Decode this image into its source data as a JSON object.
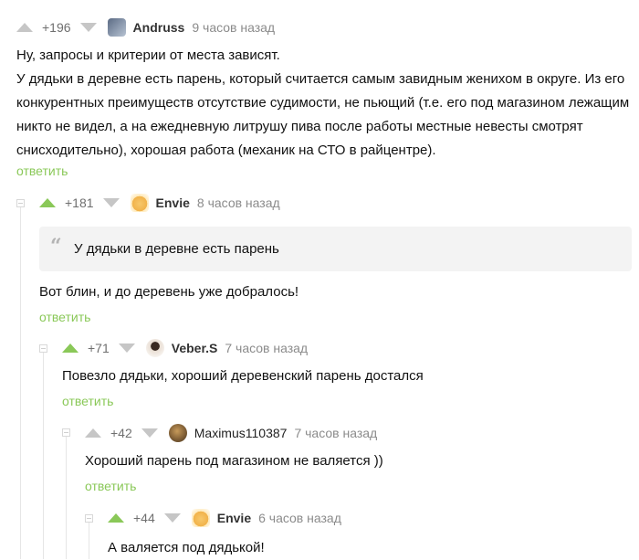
{
  "comments": [
    {
      "score": "+196",
      "author": "Andruss",
      "time": "9 часов назад",
      "lines": [
        "Ну, запросы и критерии от места зависят.",
        "У дядьки в деревне есть парень, который считается самым завидным женихом в округе. Из его",
        "конкурентных преимуществ отсутствие судимости, не пьющий (т.е. его под магазином лежащим",
        "никто не видел, а на ежедневную литрушу пива после работы местные невесты смотрят",
        "снисходительно), хорошая работа (механик на СТО в райцентре)."
      ],
      "reply": "ответить"
    },
    {
      "score": "+181",
      "author": "Envie",
      "time": "8 часов назад",
      "quote": "У дядьки в деревне есть парень",
      "text": "Вот блин, и до деревень уже добралось!",
      "reply": "ответить"
    },
    {
      "score": "+71",
      "author": "Veber.S",
      "time": "7 часов назад",
      "text": "Повезло дядьки, хороший деревенский парень достался",
      "reply": "ответить"
    },
    {
      "score": "+42",
      "author": "Maximus110387",
      "time": "7 часов назад",
      "text": "Хороший парень под магазином не валяется ))",
      "reply": "ответить"
    },
    {
      "score": "+44",
      "author": "Envie",
      "time": "6 часов назад",
      "text": "А валяется под дядькой!"
    }
  ],
  "colors": {
    "accent": "#8ac858",
    "muted": "#8b8b8b",
    "quote_bg": "#f3f3f3"
  }
}
